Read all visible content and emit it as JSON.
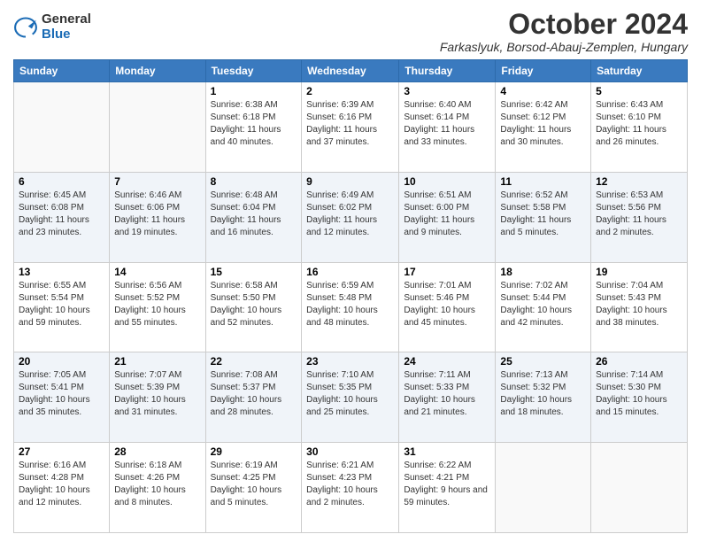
{
  "header": {
    "logo_general": "General",
    "logo_blue": "Blue",
    "month_title": "October 2024",
    "location": "Farkaslyuk, Borsod-Abauj-Zemplen, Hungary"
  },
  "days_of_week": [
    "Sunday",
    "Monday",
    "Tuesday",
    "Wednesday",
    "Thursday",
    "Friday",
    "Saturday"
  ],
  "weeks": [
    [
      {
        "day": "",
        "info": ""
      },
      {
        "day": "",
        "info": ""
      },
      {
        "day": "1",
        "info": "Sunrise: 6:38 AM\nSunset: 6:18 PM\nDaylight: 11 hours and 40 minutes."
      },
      {
        "day": "2",
        "info": "Sunrise: 6:39 AM\nSunset: 6:16 PM\nDaylight: 11 hours and 37 minutes."
      },
      {
        "day": "3",
        "info": "Sunrise: 6:40 AM\nSunset: 6:14 PM\nDaylight: 11 hours and 33 minutes."
      },
      {
        "day": "4",
        "info": "Sunrise: 6:42 AM\nSunset: 6:12 PM\nDaylight: 11 hours and 30 minutes."
      },
      {
        "day": "5",
        "info": "Sunrise: 6:43 AM\nSunset: 6:10 PM\nDaylight: 11 hours and 26 minutes."
      }
    ],
    [
      {
        "day": "6",
        "info": "Sunrise: 6:45 AM\nSunset: 6:08 PM\nDaylight: 11 hours and 23 minutes."
      },
      {
        "day": "7",
        "info": "Sunrise: 6:46 AM\nSunset: 6:06 PM\nDaylight: 11 hours and 19 minutes."
      },
      {
        "day": "8",
        "info": "Sunrise: 6:48 AM\nSunset: 6:04 PM\nDaylight: 11 hours and 16 minutes."
      },
      {
        "day": "9",
        "info": "Sunrise: 6:49 AM\nSunset: 6:02 PM\nDaylight: 11 hours and 12 minutes."
      },
      {
        "day": "10",
        "info": "Sunrise: 6:51 AM\nSunset: 6:00 PM\nDaylight: 11 hours and 9 minutes."
      },
      {
        "day": "11",
        "info": "Sunrise: 6:52 AM\nSunset: 5:58 PM\nDaylight: 11 hours and 5 minutes."
      },
      {
        "day": "12",
        "info": "Sunrise: 6:53 AM\nSunset: 5:56 PM\nDaylight: 11 hours and 2 minutes."
      }
    ],
    [
      {
        "day": "13",
        "info": "Sunrise: 6:55 AM\nSunset: 5:54 PM\nDaylight: 10 hours and 59 minutes."
      },
      {
        "day": "14",
        "info": "Sunrise: 6:56 AM\nSunset: 5:52 PM\nDaylight: 10 hours and 55 minutes."
      },
      {
        "day": "15",
        "info": "Sunrise: 6:58 AM\nSunset: 5:50 PM\nDaylight: 10 hours and 52 minutes."
      },
      {
        "day": "16",
        "info": "Sunrise: 6:59 AM\nSunset: 5:48 PM\nDaylight: 10 hours and 48 minutes."
      },
      {
        "day": "17",
        "info": "Sunrise: 7:01 AM\nSunset: 5:46 PM\nDaylight: 10 hours and 45 minutes."
      },
      {
        "day": "18",
        "info": "Sunrise: 7:02 AM\nSunset: 5:44 PM\nDaylight: 10 hours and 42 minutes."
      },
      {
        "day": "19",
        "info": "Sunrise: 7:04 AM\nSunset: 5:43 PM\nDaylight: 10 hours and 38 minutes."
      }
    ],
    [
      {
        "day": "20",
        "info": "Sunrise: 7:05 AM\nSunset: 5:41 PM\nDaylight: 10 hours and 35 minutes."
      },
      {
        "day": "21",
        "info": "Sunrise: 7:07 AM\nSunset: 5:39 PM\nDaylight: 10 hours and 31 minutes."
      },
      {
        "day": "22",
        "info": "Sunrise: 7:08 AM\nSunset: 5:37 PM\nDaylight: 10 hours and 28 minutes."
      },
      {
        "day": "23",
        "info": "Sunrise: 7:10 AM\nSunset: 5:35 PM\nDaylight: 10 hours and 25 minutes."
      },
      {
        "day": "24",
        "info": "Sunrise: 7:11 AM\nSunset: 5:33 PM\nDaylight: 10 hours and 21 minutes."
      },
      {
        "day": "25",
        "info": "Sunrise: 7:13 AM\nSunset: 5:32 PM\nDaylight: 10 hours and 18 minutes."
      },
      {
        "day": "26",
        "info": "Sunrise: 7:14 AM\nSunset: 5:30 PM\nDaylight: 10 hours and 15 minutes."
      }
    ],
    [
      {
        "day": "27",
        "info": "Sunrise: 6:16 AM\nSunset: 4:28 PM\nDaylight: 10 hours and 12 minutes."
      },
      {
        "day": "28",
        "info": "Sunrise: 6:18 AM\nSunset: 4:26 PM\nDaylight: 10 hours and 8 minutes."
      },
      {
        "day": "29",
        "info": "Sunrise: 6:19 AM\nSunset: 4:25 PM\nDaylight: 10 hours and 5 minutes."
      },
      {
        "day": "30",
        "info": "Sunrise: 6:21 AM\nSunset: 4:23 PM\nDaylight: 10 hours and 2 minutes."
      },
      {
        "day": "31",
        "info": "Sunrise: 6:22 AM\nSunset: 4:21 PM\nDaylight: 9 hours and 59 minutes."
      },
      {
        "day": "",
        "info": ""
      },
      {
        "day": "",
        "info": ""
      }
    ]
  ]
}
